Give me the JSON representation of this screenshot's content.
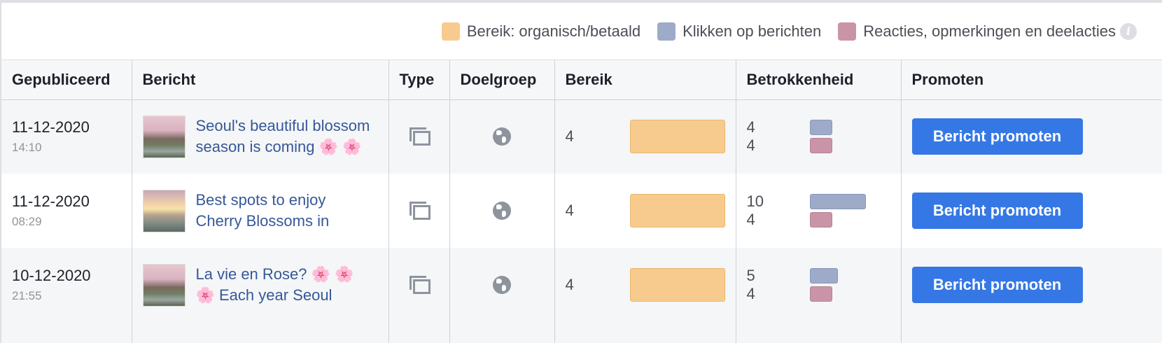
{
  "legend": {
    "items": [
      {
        "label": "Bereik: organisch/betaald",
        "color": "#f7cb8e"
      },
      {
        "label": "Klikken op berichten",
        "color": "#9dabc9"
      },
      {
        "label": "Reacties, opmerkingen en deelacties",
        "color": "#c994a8"
      }
    ],
    "info_icon": "i"
  },
  "columns": [
    "Gepubliceerd",
    "Bericht",
    "Type",
    "Doelgroep",
    "Bereik",
    "Betrokkenheid",
    "Promoten"
  ],
  "rows": [
    {
      "date": "11-12-2020",
      "time": "14:10",
      "post_line1": "Seoul's beautiful blossom",
      "post_line2": "season is coming 🌸 🌸",
      "type_icon": "multi-photo-icon",
      "audience_icon": "globe-icon",
      "reach": "4",
      "reach_fraction": 1.0,
      "clicks": "4",
      "clicks_fraction": 0.4,
      "reactions": "4",
      "reactions_fraction": 0.4,
      "promote_label": "Bericht promoten"
    },
    {
      "date": "11-12-2020",
      "time": "08:29",
      "post_line1": "Best spots to enjoy",
      "post_line2": "Cherry Blossoms in",
      "type_icon": "multi-photo-icon",
      "audience_icon": "globe-icon",
      "reach": "4",
      "reach_fraction": 1.0,
      "clicks": "10",
      "clicks_fraction": 1.0,
      "reactions": "4",
      "reactions_fraction": 0.4,
      "promote_label": "Bericht promoten"
    },
    {
      "date": "10-12-2020",
      "time": "21:55",
      "post_line1": "La vie en Rose? 🌸 🌸",
      "post_line2": "🌸 Each year Seoul",
      "type_icon": "multi-photo-icon",
      "audience_icon": "globe-icon",
      "reach": "4",
      "reach_fraction": 1.0,
      "clicks": "5",
      "clicks_fraction": 0.5,
      "reactions": "4",
      "reactions_fraction": 0.4,
      "promote_label": "Bericht promoten"
    }
  ]
}
